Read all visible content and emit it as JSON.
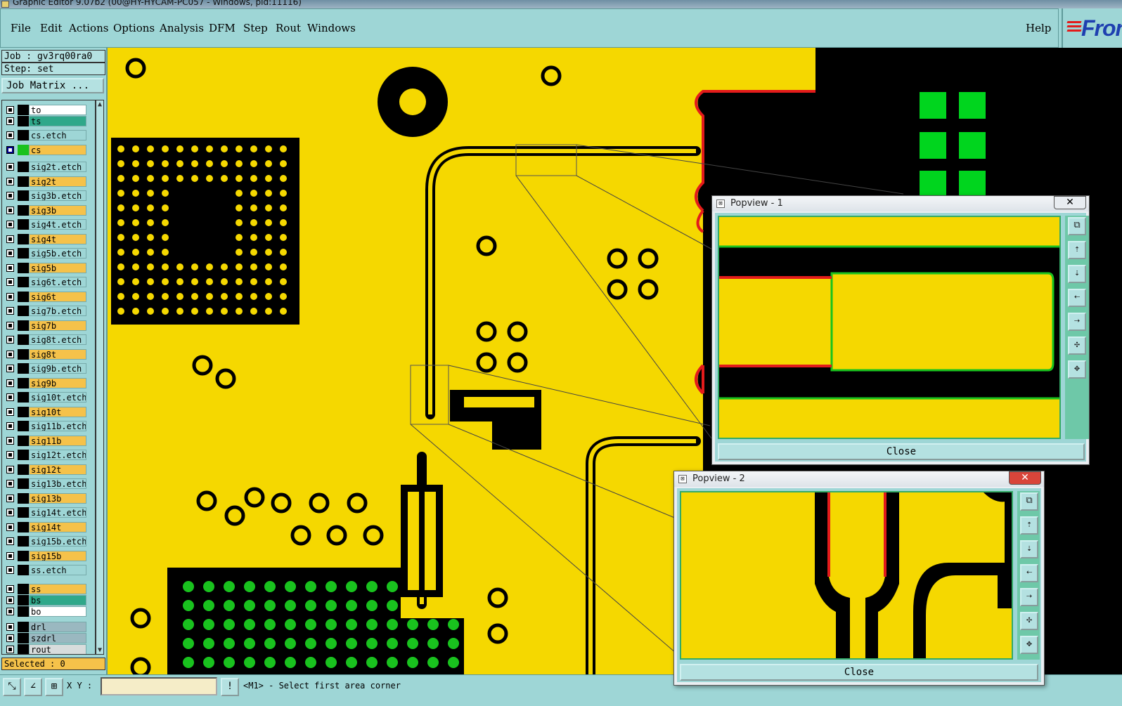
{
  "window": {
    "title": "Graphic Editor 9.07b2 (00@HY-HYCAM-PC057 - Windows, pid:11116)"
  },
  "menu": {
    "items": [
      "File",
      "Edit",
      "Actions",
      "Options",
      "Analysis",
      "DFM",
      "Step",
      "Rout",
      "Windows"
    ],
    "help": "Help"
  },
  "logo": {
    "text": "Fron"
  },
  "job": {
    "job_label": "Job : gv3rq00ra0",
    "step_label": "Step: set",
    "matrix_button": "Job Matrix ..."
  },
  "layers": [
    {
      "name": "to",
      "color": "#ffffff",
      "swatch": "#000000"
    },
    {
      "name": "ts",
      "color": "#2fa88a",
      "swatch": "#000000"
    },
    {
      "name": "cs.etch",
      "color": "#9ed6d6",
      "swatch": "#000000"
    },
    {
      "name": "cs",
      "color": "#f5c24a",
      "swatch": "#19c21e",
      "active": true
    },
    {
      "name": "sig2t.etch",
      "color": "#9ed6d6",
      "swatch": "#000000"
    },
    {
      "name": "sig2t",
      "color": "#f5c24a",
      "swatch": "#000000"
    },
    {
      "name": "sig3b.etch",
      "color": "#9ed6d6",
      "swatch": "#000000"
    },
    {
      "name": "sig3b",
      "color": "#f5c24a",
      "swatch": "#000000"
    },
    {
      "name": "sig4t.etch",
      "color": "#9ed6d6",
      "swatch": "#000000"
    },
    {
      "name": "sig4t",
      "color": "#f5c24a",
      "swatch": "#000000"
    },
    {
      "name": "sig5b.etch",
      "color": "#9ed6d6",
      "swatch": "#000000"
    },
    {
      "name": "sig5b",
      "color": "#f5c24a",
      "swatch": "#000000"
    },
    {
      "name": "sig6t.etch",
      "color": "#9ed6d6",
      "swatch": "#000000"
    },
    {
      "name": "sig6t",
      "color": "#f5c24a",
      "swatch": "#000000"
    },
    {
      "name": "sig7b.etch",
      "color": "#9ed6d6",
      "swatch": "#000000"
    },
    {
      "name": "sig7b",
      "color": "#f5c24a",
      "swatch": "#000000"
    },
    {
      "name": "sig8t.etch",
      "color": "#9ed6d6",
      "swatch": "#000000"
    },
    {
      "name": "sig8t",
      "color": "#f5c24a",
      "swatch": "#000000"
    },
    {
      "name": "sig9b.etch",
      "color": "#9ed6d6",
      "swatch": "#000000"
    },
    {
      "name": "sig9b",
      "color": "#f5c24a",
      "swatch": "#000000"
    },
    {
      "name": "sig10t.etch",
      "color": "#9ed6d6",
      "swatch": "#000000"
    },
    {
      "name": "sig10t",
      "color": "#f5c24a",
      "swatch": "#000000"
    },
    {
      "name": "sig11b.etch",
      "color": "#9ed6d6",
      "swatch": "#000000"
    },
    {
      "name": "sig11b",
      "color": "#f5c24a",
      "swatch": "#000000"
    },
    {
      "name": "sig12t.etch",
      "color": "#9ed6d6",
      "swatch": "#000000"
    },
    {
      "name": "sig12t",
      "color": "#f5c24a",
      "swatch": "#000000"
    },
    {
      "name": "sig13b.etch",
      "color": "#9ed6d6",
      "swatch": "#000000"
    },
    {
      "name": "sig13b",
      "color": "#f5c24a",
      "swatch": "#000000"
    },
    {
      "name": "sig14t.etch",
      "color": "#9ed6d6",
      "swatch": "#000000"
    },
    {
      "name": "sig14t",
      "color": "#f5c24a",
      "swatch": "#000000"
    },
    {
      "name": "sig15b.etch",
      "color": "#9ed6d6",
      "swatch": "#000000"
    },
    {
      "name": "sig15b",
      "color": "#f5c24a",
      "swatch": "#000000"
    },
    {
      "name": "ss.etch",
      "color": "#9ed6d6",
      "swatch": "#000000"
    },
    {
      "name": "ss",
      "color": "#f5c24a",
      "swatch": "#000000"
    },
    {
      "name": "bs",
      "color": "#2fa88a",
      "swatch": "#000000"
    },
    {
      "name": "bo",
      "color": "#ffffff",
      "swatch": "#000000"
    },
    {
      "name": "drl",
      "color": "#9ab8c0",
      "swatch": "#000000"
    },
    {
      "name": "szdrl",
      "color": "#9ab8c0",
      "swatch": "#000000"
    },
    {
      "name": "rout",
      "color": "#d8dcdc",
      "swatch": "#000000"
    }
  ],
  "selected": "Selected : 0",
  "status": {
    "xy_label": "X Y :",
    "message": "<M1> - Select first area corner",
    "xy_value": ""
  },
  "popview1": {
    "title": "Popview - 1",
    "close_label": "Close",
    "x_label": "✕"
  },
  "popview2": {
    "title": "Popview - 2",
    "close_label": "Close",
    "x_label": "✕"
  },
  "colors": {
    "board": "#f5d800",
    "copper": "#000000",
    "highlight": "#19c21e",
    "red_outline": "#e31b1b"
  }
}
